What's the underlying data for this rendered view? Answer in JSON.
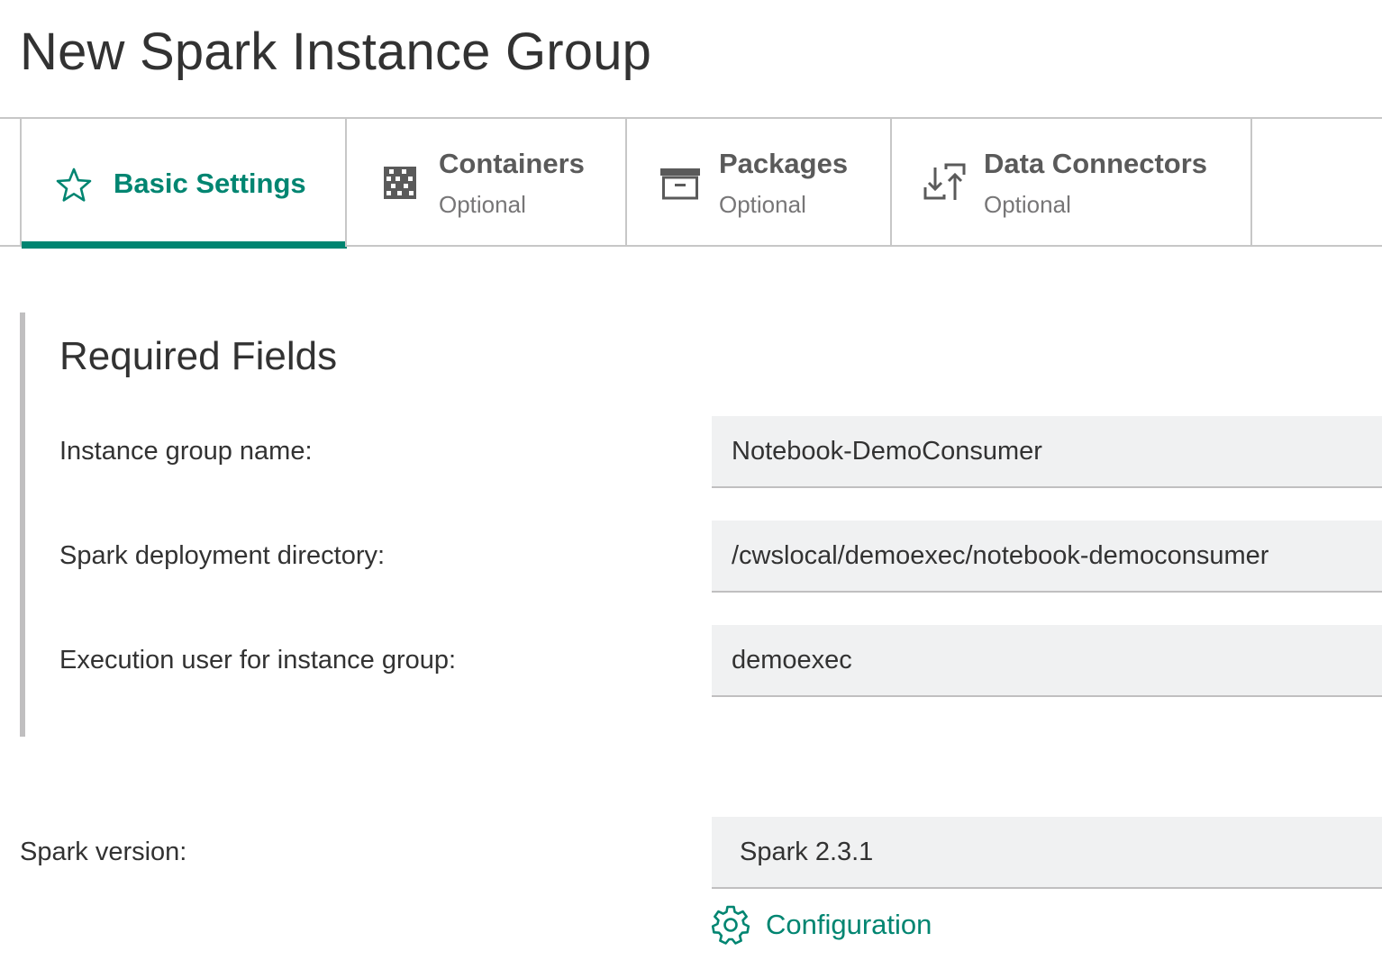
{
  "page": {
    "title": "New Spark Instance Group"
  },
  "tabs": [
    {
      "label": "Basic Settings",
      "subtitle": "",
      "icon": "star-icon",
      "active": true
    },
    {
      "label": "Containers",
      "subtitle": "Optional",
      "icon": "grid-icon",
      "active": false
    },
    {
      "label": "Packages",
      "subtitle": "Optional",
      "icon": "archive-icon",
      "active": false
    },
    {
      "label": "Data Connectors",
      "subtitle": "Optional",
      "icon": "transfer-icon",
      "active": false
    }
  ],
  "required_fields": {
    "title": "Required Fields",
    "instance_group_name": {
      "label": "Instance group name:",
      "value": "Notebook-DemoConsumer"
    },
    "deployment_directory": {
      "label": "Spark deployment directory:",
      "value": "/cwslocal/demoexec/notebook-democonsumer"
    },
    "execution_user": {
      "label": "Execution user for instance group:",
      "value": "demoexec"
    }
  },
  "spark_version": {
    "label": "Spark version:",
    "value": "Spark 2.3.1"
  },
  "configuration_link": {
    "label": "Configuration",
    "icon": "gear-icon"
  },
  "colors": {
    "accent": "#008571",
    "text": "#323232",
    "muted": "#777677",
    "border": "#c7c7c7",
    "input_bg": "#f0f1f2"
  }
}
